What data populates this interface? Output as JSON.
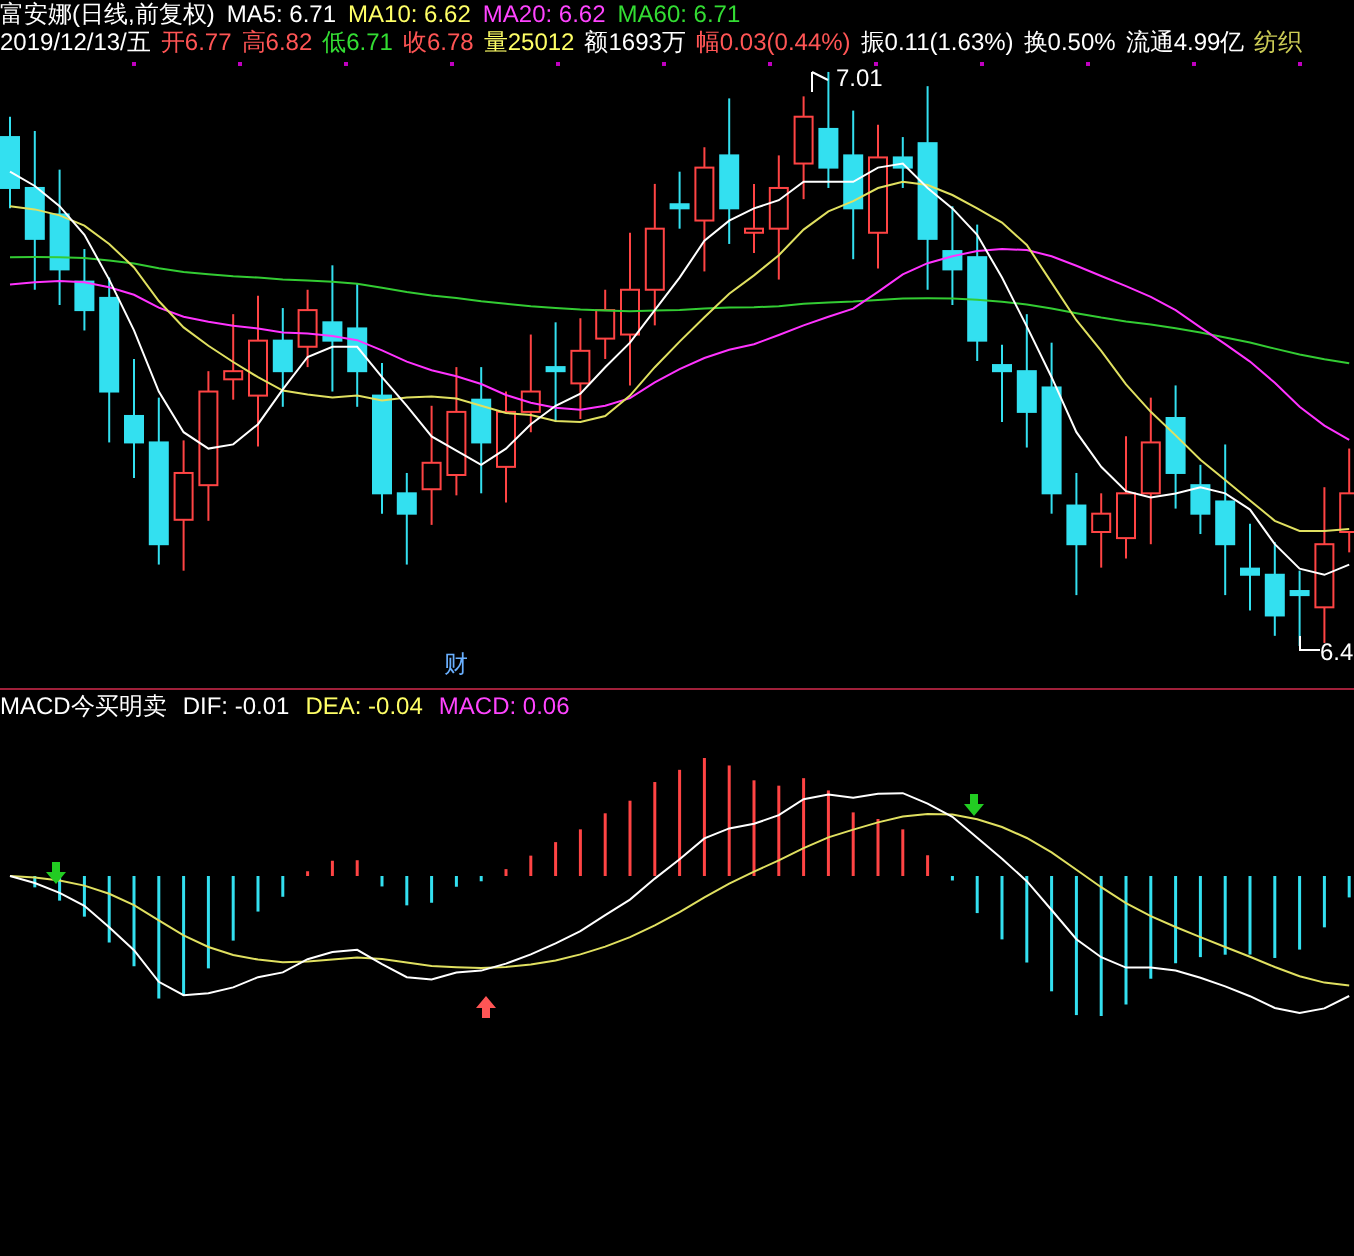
{
  "title_bar": {
    "items": [
      {
        "text": "富安娜(日线,前复权)",
        "color": "#ffffff"
      },
      {
        "text": "MA5: 6.71",
        "color": "#ffffff"
      },
      {
        "text": "MA10: 6.62",
        "color": "#ffff66"
      },
      {
        "text": "MA20: 6.62",
        "color": "#ff44ff"
      },
      {
        "text": "MA60: 6.71",
        "color": "#33dd33"
      }
    ]
  },
  "quote_bar": {
    "items": [
      {
        "text": "2019/12/13/五",
        "color": "#ffffff"
      },
      {
        "text": "开6.77",
        "color": "#ff5555"
      },
      {
        "text": "高6.82",
        "color": "#ff5555"
      },
      {
        "text": "低6.71",
        "color": "#33dd33"
      },
      {
        "text": "收6.78",
        "color": "#ff5555"
      },
      {
        "text": "量25012",
        "color": "#ffff66"
      },
      {
        "text": "额1693万",
        "color": "#ffffff"
      },
      {
        "text": "幅0.03(0.44%)",
        "color": "#ff5555"
      },
      {
        "text": "振0.11(1.63%)",
        "color": "#ffffff"
      },
      {
        "text": "换0.50%",
        "color": "#ffffff"
      },
      {
        "text": "流通4.99亿",
        "color": "#ffffff"
      },
      {
        "text": "纺织",
        "color": "#cccc55"
      }
    ]
  },
  "chart": {
    "high_label": "7.01",
    "low_label": "6.4",
    "event_marker": "财"
  },
  "macd_bar": {
    "items": [
      {
        "text": "MACD今买明卖",
        "color": "#ffffff"
      },
      {
        "text": "DIF: -0.01",
        "color": "#ffffff"
      },
      {
        "text": "DEA: -0.04",
        "color": "#ffff66"
      },
      {
        "text": "MACD: 0.06",
        "color": "#ff44ff"
      }
    ]
  }
}
